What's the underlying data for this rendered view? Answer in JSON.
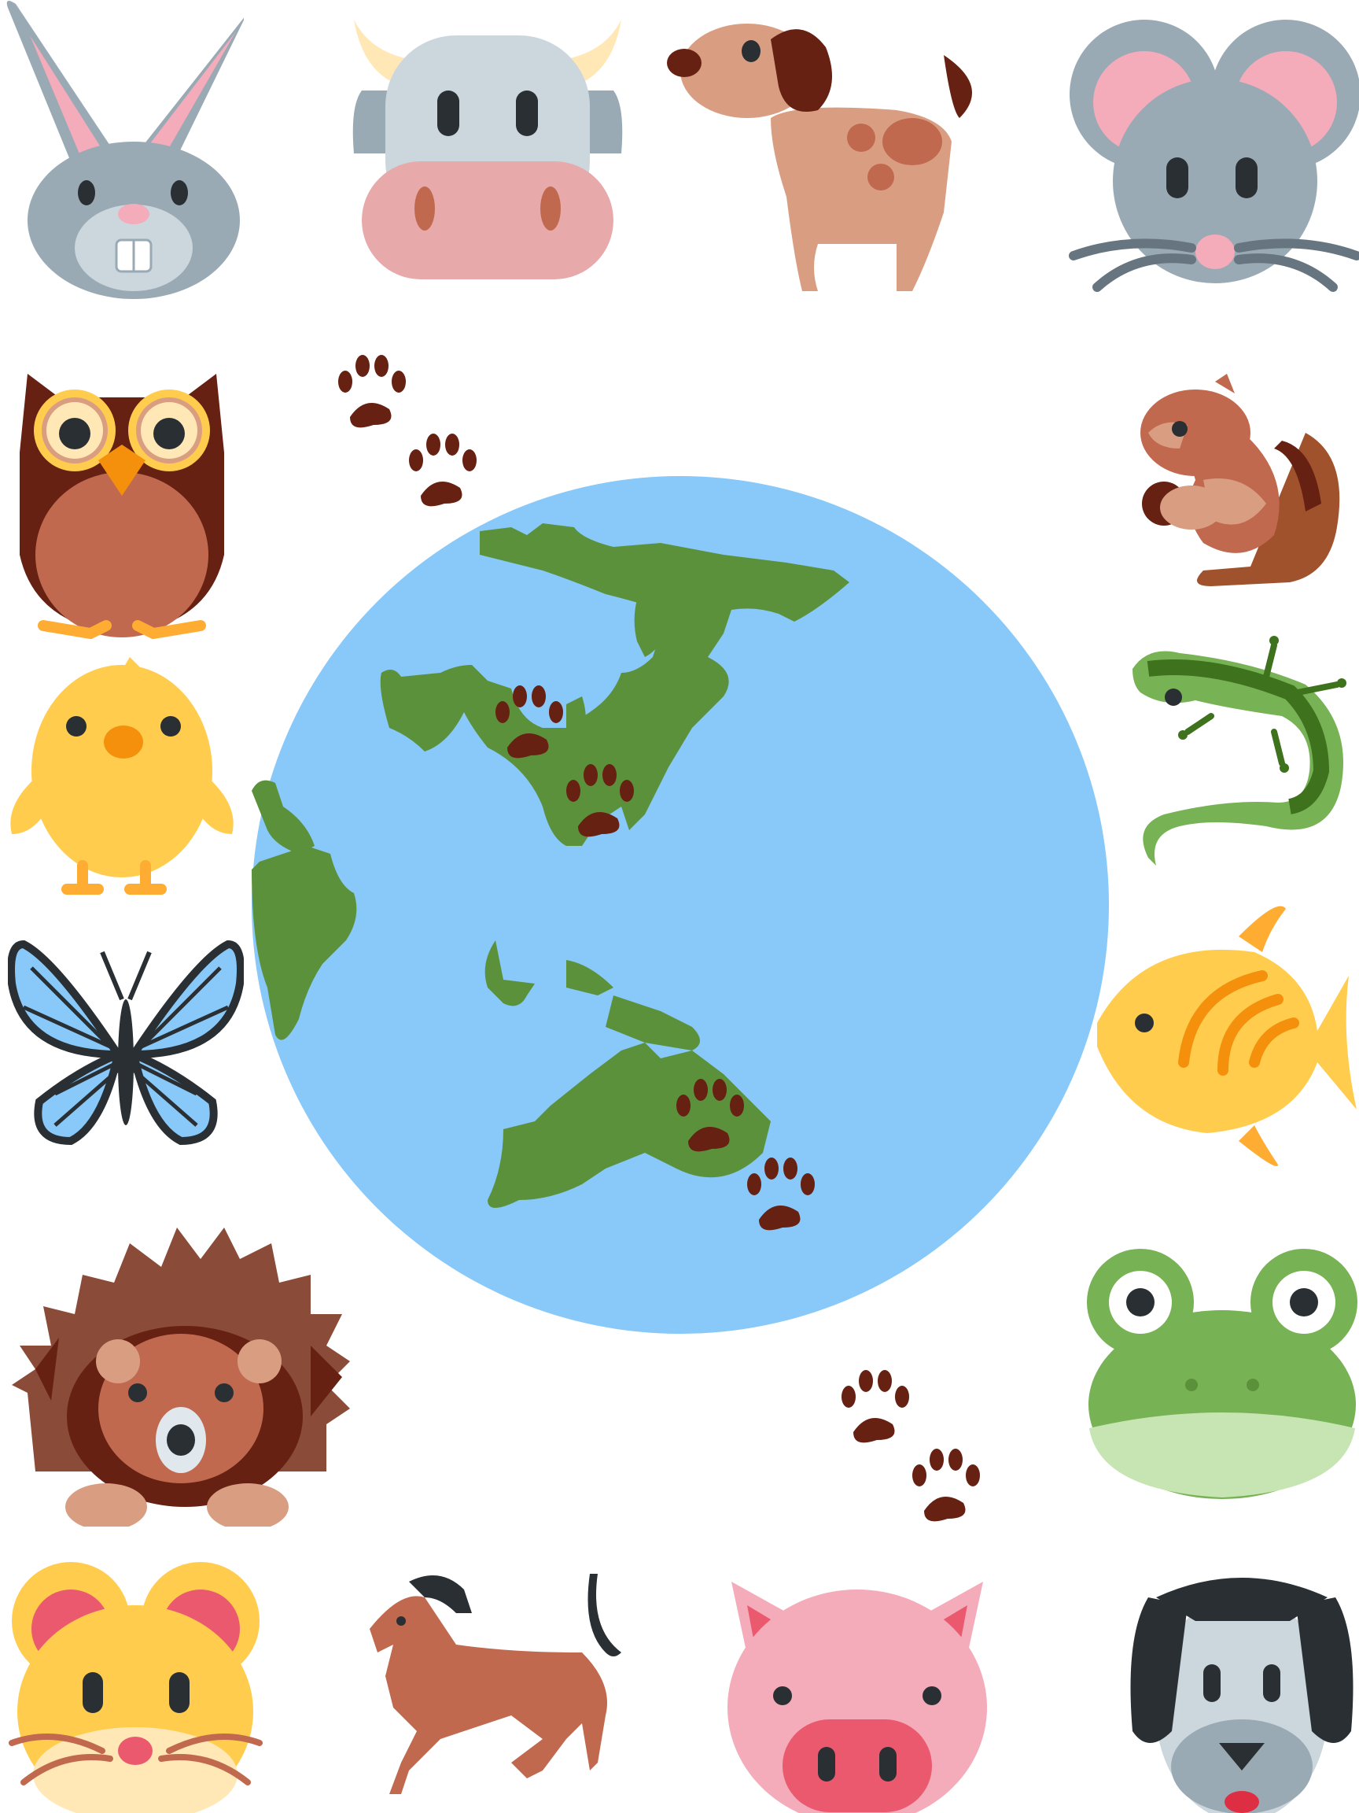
{
  "artwork": {
    "icons": [
      "rabbit-face-icon",
      "cow-face-icon",
      "dog-icon",
      "mouse-face-icon",
      "owl-icon",
      "chipmunk-icon",
      "baby-chick-icon",
      "lizard-icon",
      "butterfly-icon",
      "tropical-fish-icon",
      "hedgehog-icon",
      "frog-face-icon",
      "hamster-face-icon",
      "horse-icon",
      "pig-face-icon",
      "dog-face-icon",
      "globe-asia-australia-icon",
      "paw-prints-icon"
    ],
    "colors": {
      "ocean": "#88C9F9",
      "land": "#5C913B",
      "paw": "#662113",
      "background": "#FFFFFF"
    }
  }
}
